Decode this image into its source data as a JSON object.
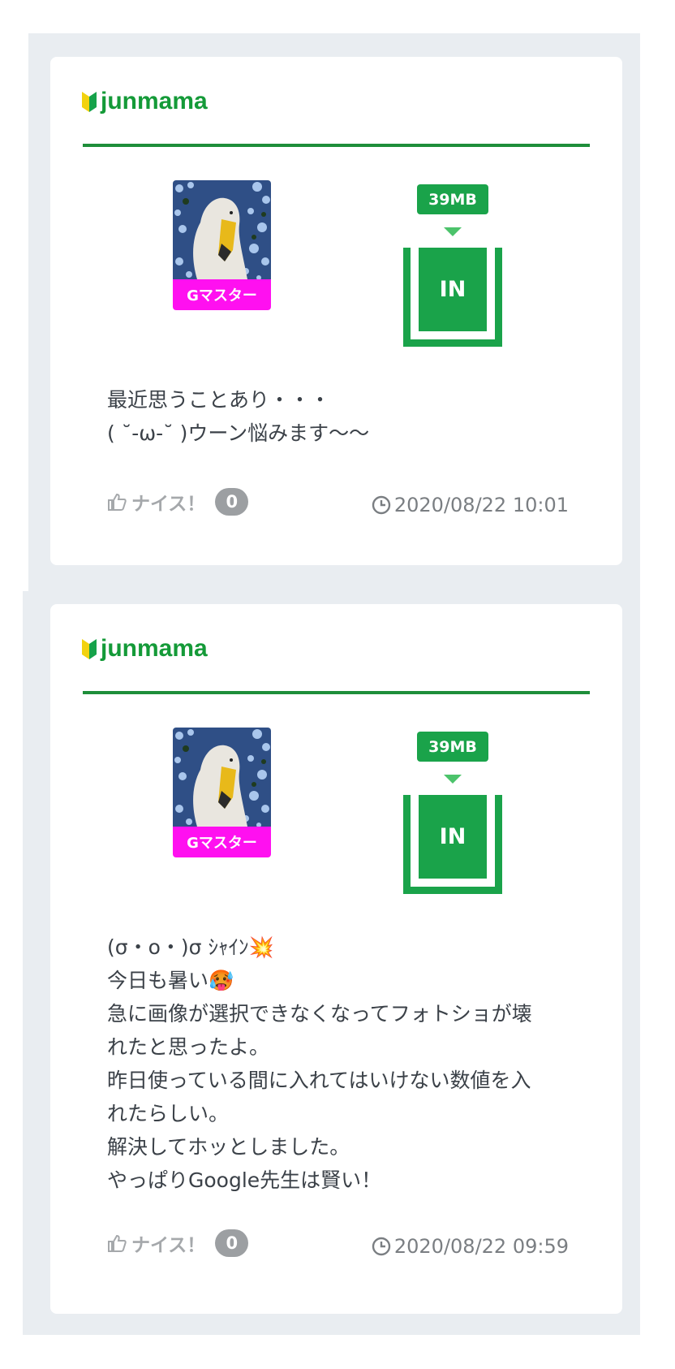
{
  "colors": {
    "brand_green": "#1aa34a",
    "rank_badge": "#ff10f0",
    "panel_bg": "#e9edf1"
  },
  "posts": [
    {
      "username": "junmama",
      "beginner_icon": "beginner-mark-icon",
      "rank": "Gマスター",
      "data_size": "39MB",
      "status": "IN",
      "message_lines": [
        "最近思うことあり・・・",
        "( ˘-ω-˘ )ウーン悩みます〜〜"
      ],
      "nice_label": "ナイス！",
      "nice_count": "0",
      "timestamp": "2020/08/22 10:01"
    },
    {
      "username": "junmama",
      "beginner_icon": "beginner-mark-icon",
      "rank": "Gマスター",
      "data_size": "39MB",
      "status": "IN",
      "message_lines": [
        "(σ・o・)σ ｼｬｲﾝ💥",
        "今日も暑い🥵",
        "急に画像が選択できなくなってフォトショが壊",
        "れたと思ったよ。",
        "昨日使っている間に入れてはいけない数値を入",
        "れたらしい。",
        "解決してホッとしました。",
        "やっぱりGoogle先生は賢い！"
      ],
      "nice_label": "ナイス！",
      "nice_count": "0",
      "timestamp": "2020/08/22 09:59"
    }
  ]
}
